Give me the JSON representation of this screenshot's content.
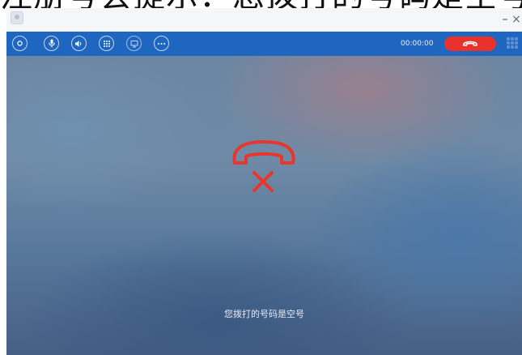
{
  "page": {
    "heading": "注册号会提示：您拨打的号码是空号。显"
  },
  "window": {
    "minimize_symbol": "–",
    "close_symbol": "×"
  },
  "toolbar": {
    "buttons": [
      {
        "name": "record-icon"
      },
      {
        "name": "microphone-icon"
      },
      {
        "name": "speaker-icon"
      },
      {
        "name": "dialpad-icon"
      },
      {
        "name": "screen-share-icon"
      },
      {
        "name": "more-icon"
      }
    ],
    "timer": "00:00:00",
    "hangup_color": "#e7332b",
    "bar_color": "#1f66c1"
  },
  "call": {
    "status_icon": "call-failed-icon",
    "status_icon_color": "#e8362c",
    "status_text": "您拨打的号码是空号"
  }
}
